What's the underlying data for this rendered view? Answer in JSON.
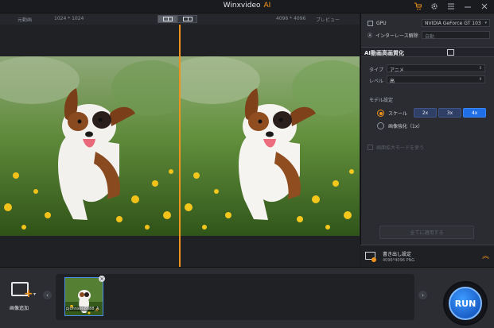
{
  "app": {
    "title": "Winxvideo",
    "title_ai": "AI"
  },
  "titlebar_icons": [
    "cart-icon",
    "settings-icon",
    "menu-icon",
    "minimize-icon",
    "close-icon"
  ],
  "preview_header": {
    "original_label": "元動画",
    "original_res": "1024 * 1024",
    "output_res": "4096 * 4096",
    "preview_label": "プレビュー"
  },
  "side_panel": {
    "gpu_label": "GPU",
    "gpu_value": "NVIDIA GeForce GT 103",
    "interlace_label": "インターレース解除",
    "interlace_value": "自動",
    "section_title": "AI動画高画質化",
    "type_label": "タイプ",
    "type_value": "アニメ",
    "level_label": "レベル",
    "level_value": "高",
    "model_label": "モデル設定",
    "scale_label": "スケール",
    "scale_options": [
      "2x",
      "3x",
      "4x"
    ],
    "scale_selected": "4x",
    "enhance_label": "画像強化（1x）",
    "keep_label": "画面拡大モードを使う",
    "apply_label": "全てに適用する"
  },
  "export": {
    "title": "書き出し設定",
    "subtitle": "4096*4096 PNG"
  },
  "bottom": {
    "add_label": "画像追加",
    "thumb_label": "pjohnson8888_A",
    "run_label": "RUN"
  },
  "colors": {
    "accent": "#f0931c",
    "blue": "#1f6ee6"
  }
}
